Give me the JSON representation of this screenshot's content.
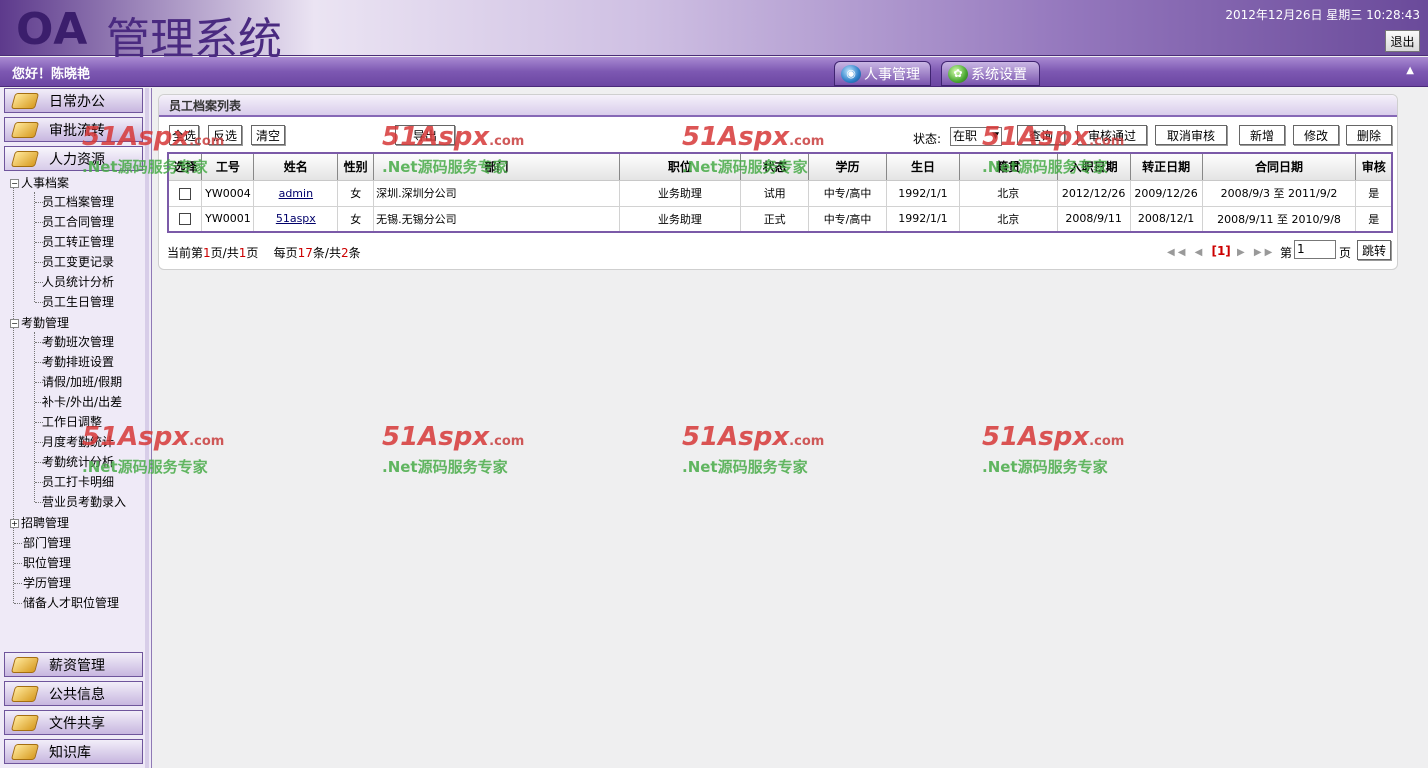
{
  "header": {
    "logo_oa": "OA",
    "logo_text": "管理系统",
    "datetime": "2012年12月26日 星期三 10:28:43",
    "logout_label": "退出"
  },
  "subbar": {
    "welcome": "您好！陈晓艳",
    "tabs": [
      {
        "label": "人事管理",
        "icon": "globe-icon"
      },
      {
        "label": "系统设置",
        "icon": "gear-icon"
      }
    ],
    "collapse_icon": "▲"
  },
  "sidebar": {
    "top_buttons": [
      "日常办公",
      "审批流转",
      "人力资源"
    ],
    "bottom_buttons": [
      "薪资管理",
      "公共信息",
      "文件共享",
      "知识库"
    ],
    "tree": {
      "hr_archive": {
        "label": "人事档案",
        "items": [
          "员工档案管理",
          "员工合同管理",
          "员工转正管理",
          "员工变更记录",
          "人员统计分析",
          "员工生日管理"
        ]
      },
      "attendance": {
        "label": "考勤管理",
        "items": [
          "考勤班次管理",
          "考勤排班设置",
          "请假/加班/假期",
          "补卡/外出/出差",
          "工作日调整",
          "月度考勤统计",
          "考勤统计分析",
          "员工打卡明细",
          "营业员考勤录入"
        ]
      },
      "recruit": {
        "label": "招聘管理"
      },
      "others": [
        "部门管理",
        "职位管理",
        "学历管理",
        "储备人才职位管理"
      ]
    }
  },
  "panel": {
    "title": "员工档案列表",
    "toolbar": {
      "select_all": "全选",
      "invert": "反选",
      "clear": "清空",
      "export": "导出",
      "status_label": "状态:",
      "status_value": "在职",
      "query": "查询",
      "approve": "审核通过",
      "cancel_approve": "取消审核",
      "add": "新增",
      "edit": "修改",
      "delete": "删除"
    },
    "columns": [
      "选择",
      "工号",
      "姓名",
      "性别",
      "部门",
      "职位",
      "状态",
      "学历",
      "生日",
      "籍贯",
      "入职日期",
      "转正日期",
      "合同日期",
      "审核"
    ],
    "rows": [
      {
        "id": "YW0004",
        "name": "admin",
        "gender": "女",
        "dept": "深圳.深圳分公司",
        "position": "业务助理",
        "status": "试用",
        "edu": "中专/高中",
        "birthday": "1992/1/1",
        "native": "北京",
        "hire": "2012/12/26",
        "regular": "2009/12/26",
        "contract": "2008/9/3 至 2011/9/2",
        "audit": "是"
      },
      {
        "id": "YW0001",
        "name": "51aspx",
        "gender": "女",
        "dept": "无锡.无锡分公司",
        "position": "业务助理",
        "status": "正式",
        "edu": "中专/高中",
        "birthday": "1992/1/1",
        "native": "北京",
        "hire": "2008/9/11",
        "regular": "2008/12/1",
        "contract": "2008/9/11 至 2010/9/8",
        "audit": "是"
      }
    ],
    "pager": {
      "p1": "当前第",
      "current": "1",
      "p2": "页/共",
      "total_pages": "1",
      "p3": "页",
      "p4": "每页",
      "per_page": "17",
      "p5": "条/共",
      "total": "2",
      "p6": "条",
      "nav_first": "◀◀",
      "nav_prev": "◀",
      "nav_current": "[1]",
      "nav_next": "▶",
      "nav_last": "▶▶",
      "goto_label": "第",
      "page_input": "1",
      "page_unit": "页",
      "jump": "跳转"
    }
  },
  "watermark": {
    "brand": "51Aspx",
    "suffix": ".com",
    "slogan": ".Net源码服务专家"
  }
}
